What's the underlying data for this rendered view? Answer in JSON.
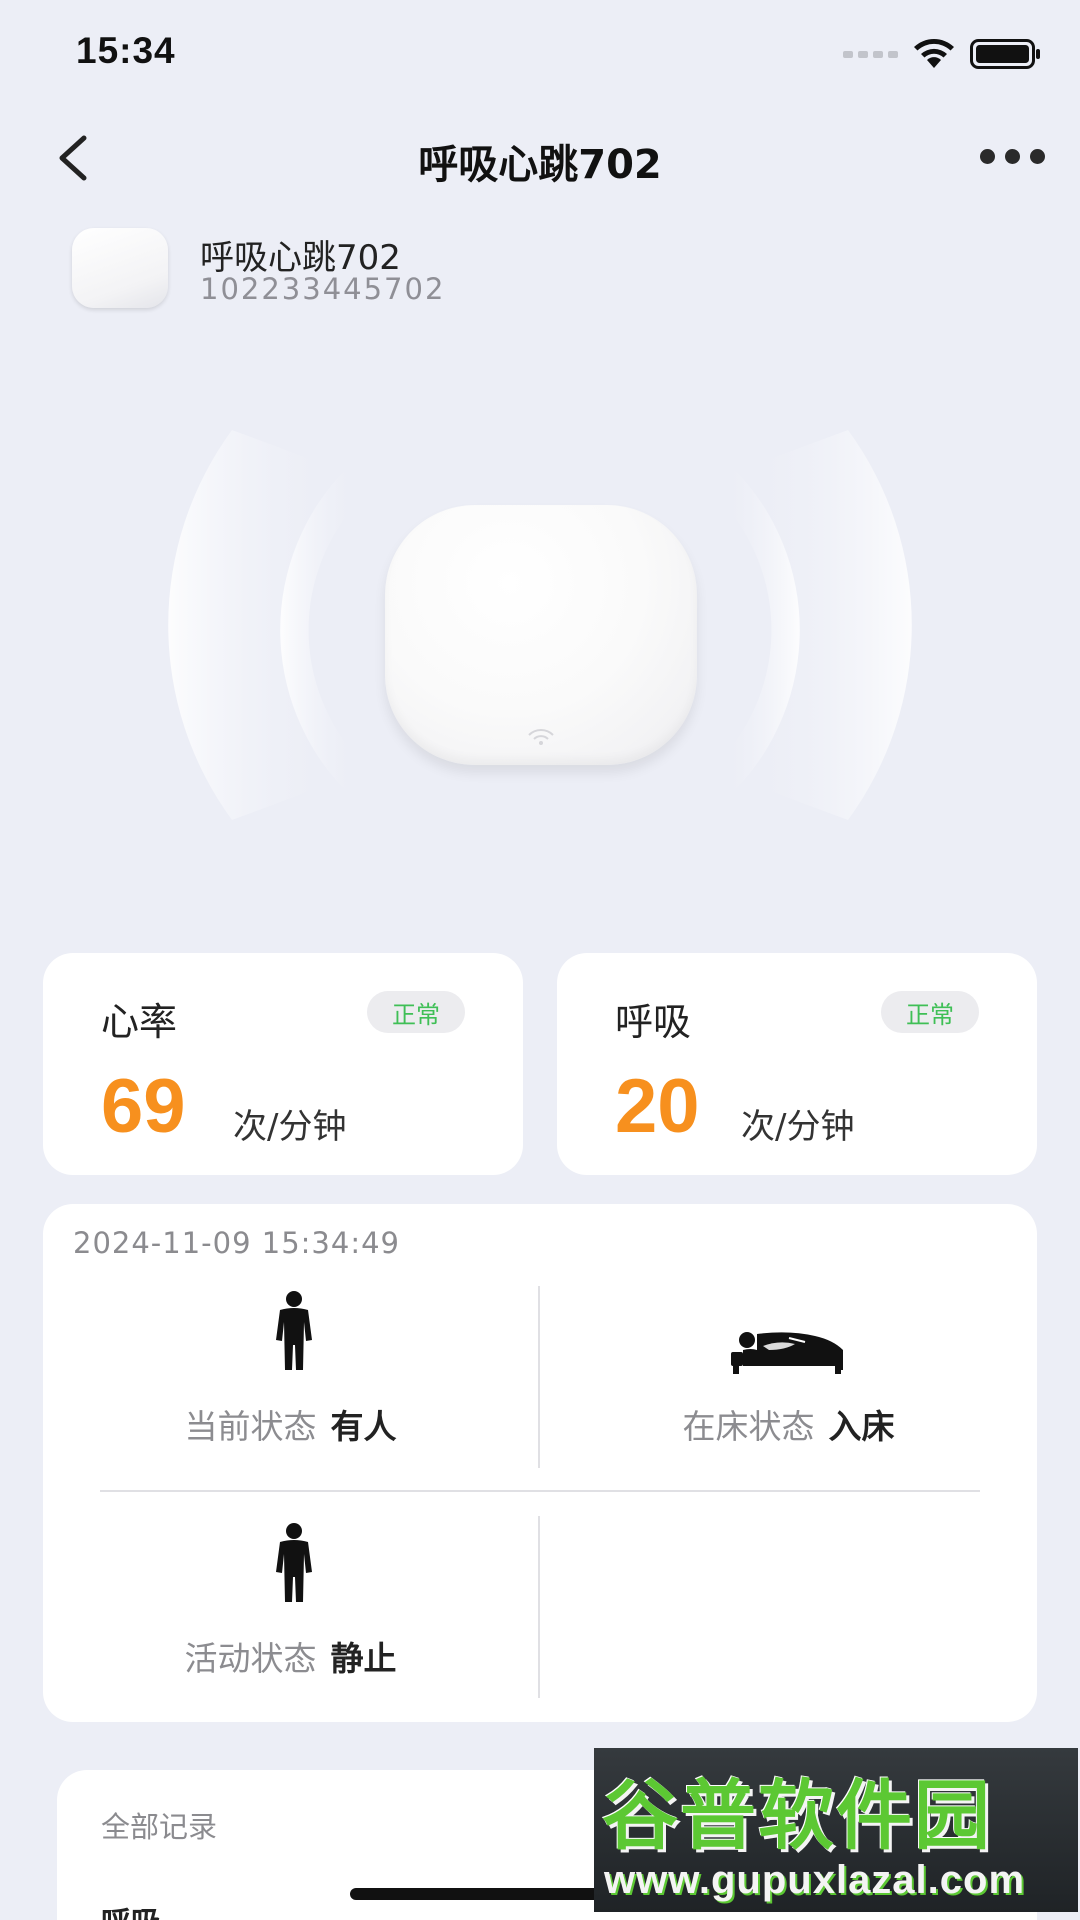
{
  "status_bar": {
    "time": "15:34"
  },
  "nav": {
    "title": "呼吸心跳702"
  },
  "device": {
    "name": "呼吸心跳702",
    "serial": "102233445702"
  },
  "metrics": [
    {
      "label": "心率",
      "badge": "正常",
      "value": "69",
      "unit": "次/分钟"
    },
    {
      "label": "呼吸",
      "badge": "正常",
      "value": "20",
      "unit": "次/分钟"
    }
  ],
  "status_panel": {
    "timestamp": "2024-11-09 15:34:49",
    "items": [
      {
        "label": "当前状态",
        "value": "有人",
        "icon": "person-standing-icon"
      },
      {
        "label": "在床状态",
        "value": "入床",
        "icon": "person-in-bed-icon"
      },
      {
        "label": "活动状态",
        "value": "静止",
        "icon": "person-standing-icon"
      }
    ]
  },
  "records": {
    "title": "全部记录",
    "first_item": "呼吸"
  },
  "watermark": {
    "text_cn": "谷普软件园",
    "text_url": "www.gupuxlazal.com"
  },
  "colors": {
    "accent_value": "#f7901e",
    "badge_text": "#3fbf56",
    "background": "#eceef6"
  }
}
